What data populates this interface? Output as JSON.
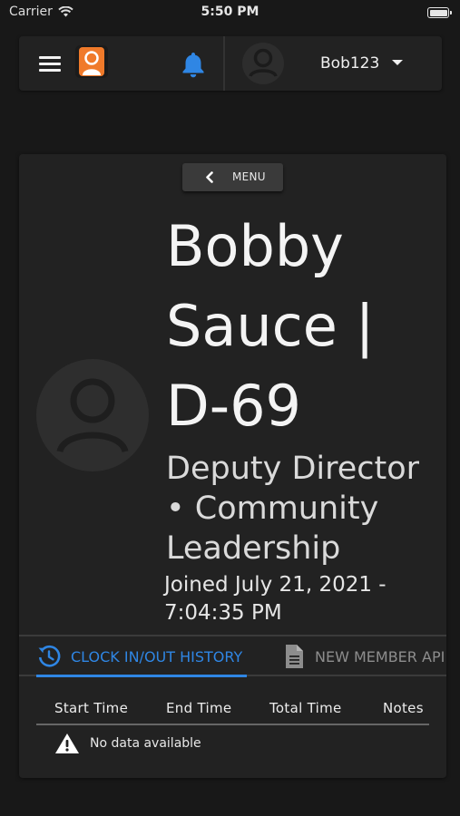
{
  "status_bar": {
    "carrier": "Carrier",
    "time": "5:50 PM"
  },
  "header": {
    "username": "Bob123",
    "accent_color": "#2f86e4"
  },
  "profile": {
    "menu_label": "MENU",
    "name_line1": "Bobby",
    "name_line2": "Sauce |",
    "name_line3": "D-69",
    "role_line1": "Deputy Director",
    "role_line2": "• Community",
    "role_line3": "Leadership",
    "joined_line1": "Joined July 21, 2021 -",
    "joined_line2": "7:04:35 PM"
  },
  "tabs": [
    {
      "label": "CLOCK IN/OUT HISTORY",
      "icon": "history-icon",
      "active": true
    },
    {
      "label": "NEW MEMBER API",
      "icon": "document-icon",
      "active": false
    }
  ],
  "table": {
    "columns": [
      "Start Time",
      "End Time",
      "Total Time",
      "Notes"
    ],
    "empty_message": "No data available"
  }
}
